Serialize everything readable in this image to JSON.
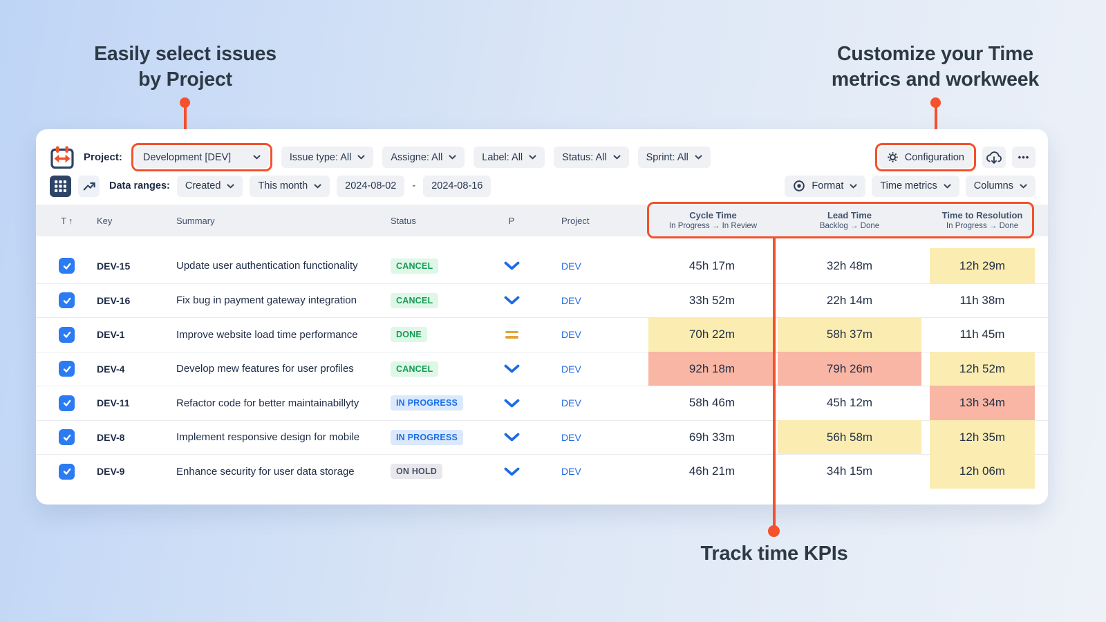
{
  "colors": {
    "accent": "#f4512c",
    "blue": "#1e6ae4",
    "navy": "#2e4466",
    "ink": "#1e2b45",
    "slate": "#42526e",
    "pill-bg": "#f0f1f4",
    "header-bg": "#eef0f3",
    "row-line": "#e9ebef",
    "cell-yellow": "#fbecb2",
    "cell-red": "#f9b6a4",
    "green-bg": "#def7e7",
    "green-text": "#169b55",
    "blue-bg": "#dbe9fd",
    "blue-text": "#1d6fe8",
    "gray-bg": "#e8e8ec",
    "gray-text": "#44506b",
    "amber": "#e2a43b",
    "annot": "#2d3a46",
    "bg-start": "#bfd5f6",
    "bg-end": "#eef2f8"
  },
  "annotations": {
    "left": {
      "line1": "Easily select issues",
      "line2": "by Project"
    },
    "right": {
      "line1": "Customize your Time",
      "line2": "metrics and workweek"
    },
    "bottom": {
      "label": "Track time KPIs"
    }
  },
  "toolbar": {
    "project_label": "Project:",
    "project_value": "Development [DEV]",
    "filters": {
      "issue_type": "Issue type: All",
      "assignee": "Assigne: All",
      "label": "Label: All",
      "status": "Status: All",
      "sprint": "Sprint: All"
    },
    "configuration_label": "Configuration",
    "more_label": "•••"
  },
  "subtoolbar": {
    "data_ranges_label": "Data ranges:",
    "created_value": "Created",
    "period_value": "This month",
    "date_from": "2024-08-02",
    "date_separator": "-",
    "date_to": "2024-08-16",
    "format_label": "Format",
    "time_metrics_label": "Time metrics",
    "columns_label": "Columns"
  },
  "table": {
    "headers": {
      "type": "T",
      "sort_arrow": "↑",
      "key": "Key",
      "summary": "Summary",
      "status": "Status",
      "priority": "P",
      "project": "Project",
      "cycle_title": "Cycle Time",
      "cycle_subtitle": "In Progress → In Review",
      "lead_title": "Lead Time",
      "lead_subtitle": "Backlog → Done",
      "ttr_title": "Time to Resolution",
      "ttr_subtitle": "In Progress → Done"
    },
    "rows": [
      {
        "key": "DEV-15",
        "summary": "Update user authentication functionality",
        "status": "CANCEL",
        "status_class": "st-green",
        "priority": "low",
        "priority_class": "prio-low",
        "project": "DEV",
        "cycle": "45h 17m",
        "cycle_class": "c-plain",
        "lead": "32h 48m",
        "lead_class": "c-plain",
        "ttr": "12h 29m",
        "ttr_class": "c-yellow"
      },
      {
        "key": "DEV-16",
        "summary": "Fix bug in payment gateway integration",
        "status": "CANCEL",
        "status_class": "st-green",
        "priority": "low",
        "priority_class": "prio-low",
        "project": "DEV",
        "cycle": "33h 52m",
        "cycle_class": "c-plain",
        "lead": "22h 14m",
        "lead_class": "c-plain",
        "ttr": "11h 38m",
        "ttr_class": "c-plain"
      },
      {
        "key": "DEV-1",
        "summary": "Improve website load time performance",
        "status": "DONE",
        "status_class": "st-green",
        "priority": "medium",
        "priority_class": "prio-medium",
        "project": "DEV",
        "cycle": "70h 22m",
        "cycle_class": "c-yellow",
        "lead": "58h 37m",
        "lead_class": "c-yellow",
        "ttr": "11h 45m",
        "ttr_class": "c-plain"
      },
      {
        "key": "DEV-4",
        "summary": "Develop mew features for user profiles",
        "status": "CANCEL",
        "status_class": "st-green",
        "priority": "low",
        "priority_class": "prio-low",
        "project": "DEV",
        "cycle": "92h 18m",
        "cycle_class": "c-red",
        "lead": "79h 26m",
        "lead_class": "c-red",
        "ttr": "12h 52m",
        "ttr_class": "c-yellow"
      },
      {
        "key": "DEV-11",
        "summary": "Refactor code for better maintainabillyty",
        "status": "IN PROGRESS",
        "status_class": "st-blue",
        "priority": "low",
        "priority_class": "prio-low",
        "project": "DEV",
        "cycle": "58h 46m",
        "cycle_class": "c-plain",
        "lead": "45h 12m",
        "lead_class": "c-plain",
        "ttr": "13h 34m",
        "ttr_class": "c-red"
      },
      {
        "key": "DEV-8",
        "summary": "Implement responsive design for mobile",
        "status": "IN PROGRESS",
        "status_class": "st-blue",
        "priority": "low",
        "priority_class": "prio-low",
        "project": "DEV",
        "cycle": "69h 33m",
        "cycle_class": "c-plain",
        "lead": "56h 58m",
        "lead_class": "c-yellow",
        "ttr": "12h 35m",
        "ttr_class": "c-yellow"
      },
      {
        "key": "DEV-9",
        "summary": "Enhance security for user data storage",
        "status": "ON HOLD",
        "status_class": "st-gray",
        "priority": "low",
        "priority_class": "prio-low",
        "project": "DEV",
        "cycle": "46h 21m",
        "cycle_class": "c-plain",
        "lead": "34h 15m",
        "lead_class": "c-plain",
        "ttr": "12h 06m",
        "ttr_class": "c-yellow"
      }
    ]
  }
}
